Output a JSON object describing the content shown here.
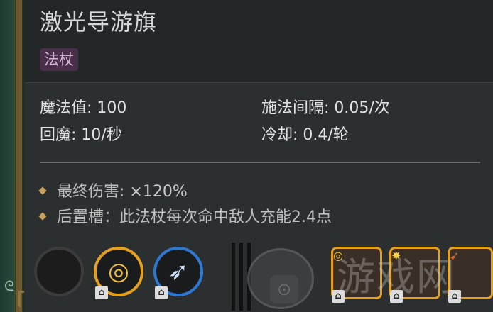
{
  "item": {
    "title": "激光导游旗",
    "tag": "法杖"
  },
  "stats": {
    "mana": "魔法值: 100",
    "recharge": "回魔: 10/秒",
    "cast_interval": "施法间隔: 0.05/次",
    "cooldown": "冷却: 0.4/轮"
  },
  "bullets": [
    {
      "label": "最终伤害:",
      "value": "×120%"
    },
    {
      "label": "后置槽：此法杖每次命中敌人充能2.4点",
      "value": ""
    }
  ],
  "slots": [
    {
      "type": "empty",
      "icon": "empty-slot"
    },
    {
      "type": "orange",
      "icon": "target-rune-icon"
    },
    {
      "type": "blue",
      "icon": "feather-icon"
    },
    {
      "type": "orange-square",
      "icon": "target-rune-icon"
    },
    {
      "type": "orange-square",
      "icon": "spark-icon"
    },
    {
      "type": "orange-square",
      "icon": "rocket-icon"
    }
  ],
  "watermark": "游戏网"
}
